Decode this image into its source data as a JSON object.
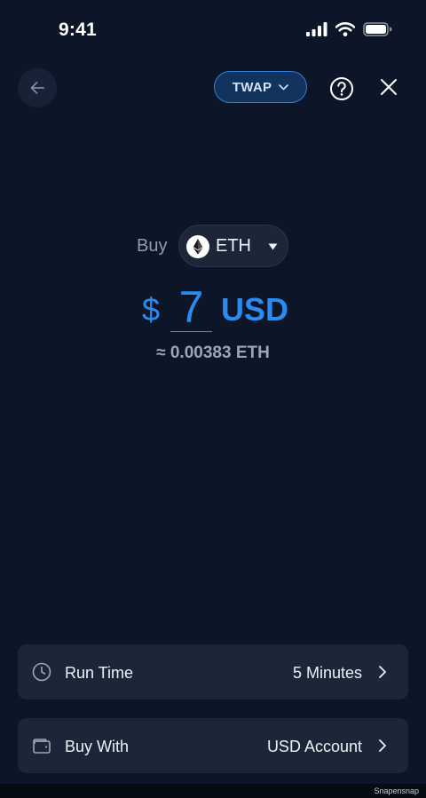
{
  "status_bar": {
    "time": "9:41"
  },
  "header": {
    "mode_label": "TWAP"
  },
  "buy": {
    "label": "Buy",
    "asset": "ETH"
  },
  "amount": {
    "currency_symbol": "$",
    "value": "7",
    "currency_code": "USD",
    "estimate": "≈ 0.00383 ETH"
  },
  "options": {
    "run_time": {
      "label": "Run Time",
      "value": "5 Minutes"
    },
    "buy_with": {
      "label": "Buy With",
      "value": "USD Account"
    }
  },
  "watermark": "Snapensnap",
  "colors": {
    "background": "#0c1628",
    "accent": "#2a8cf0",
    "card": "#1b2638"
  }
}
